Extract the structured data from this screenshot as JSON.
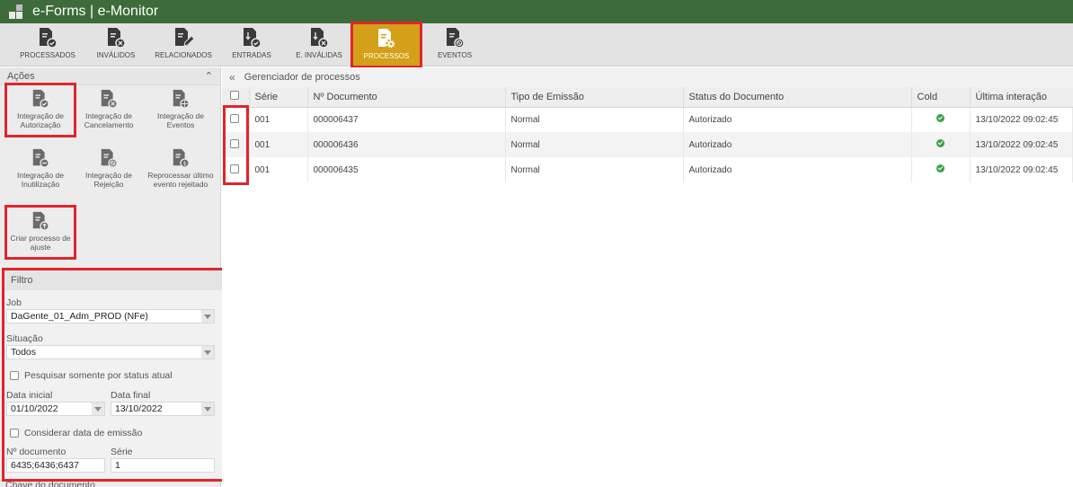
{
  "app": {
    "title": "e-Forms | e-Monitor"
  },
  "toolbar": {
    "items": [
      {
        "label": "PROCESSADOS",
        "badge": "check"
      },
      {
        "label": "INVÁLIDOS",
        "badge": "x"
      },
      {
        "label": "RELACIONADOS",
        "badge": "pen"
      },
      {
        "label": "ENTRADAS",
        "badge": "check"
      },
      {
        "label": "E. INVÁLIDAS",
        "badge": "x"
      },
      {
        "label": "PROCESSOS",
        "badge": "gear",
        "active": true
      },
      {
        "label": "EVENTOS",
        "badge": "ban"
      }
    ]
  },
  "sidebar": {
    "actions_title": "Ações",
    "actions": [
      {
        "line1": "Integração de",
        "line2": "Autorização"
      },
      {
        "line1": "Integração de",
        "line2": "Cancelamento"
      },
      {
        "line1": "Integração de",
        "line2": "Eventos"
      },
      {
        "line1": "Integração de",
        "line2": "Inutilização"
      },
      {
        "line1": "Integração de",
        "line2": "Rejeição"
      },
      {
        "line1": "Reprocessar último",
        "line2": "evento rejeitado"
      },
      {
        "line1": "Criar processo de",
        "line2": "ajuste"
      }
    ]
  },
  "filter": {
    "title": "Filtro",
    "job_label": "Job",
    "job_value": "DaGente_01_Adm_PROD (NFe)",
    "situacao_label": "Situação",
    "situacao_value": "Todos",
    "status_atual_label": "Pesquisar somente por status atual",
    "data_inicial_label": "Data inicial",
    "data_inicial_value": "01/10/2022",
    "data_final_label": "Data final",
    "data_final_value": "13/10/2022",
    "considerar_label": "Considerar data de emissão",
    "ndoc_label": "Nº documento",
    "ndoc_value": "6435;6436;6437",
    "serie_label": "Série",
    "serie_value": "1",
    "chave_label": "Chave do documento"
  },
  "main": {
    "breadcrumb": "Gerenciador de processos",
    "columns": [
      "Série",
      "Nº Documento",
      "Tipo de Emissão",
      "Status do Documento",
      "Cold",
      "Última interação"
    ],
    "rows": [
      {
        "serie": "001",
        "doc": "000006437",
        "tipo": "Normal",
        "status": "Autorizado",
        "cold": "ok",
        "ultima": "13/10/2022 09:02:45"
      },
      {
        "serie": "001",
        "doc": "000006436",
        "tipo": "Normal",
        "status": "Autorizado",
        "cold": "ok",
        "ultima": "13/10/2022 09:02:45"
      },
      {
        "serie": "001",
        "doc": "000006435",
        "tipo": "Normal",
        "status": "Autorizado",
        "cold": "ok",
        "ultima": "13/10/2022 09:02:45"
      }
    ]
  },
  "colors": {
    "titlebar": "#3d6b3a",
    "active_tab": "#d4a017",
    "highlight": "#e0252b",
    "cold_ok": "#3fa14a"
  }
}
